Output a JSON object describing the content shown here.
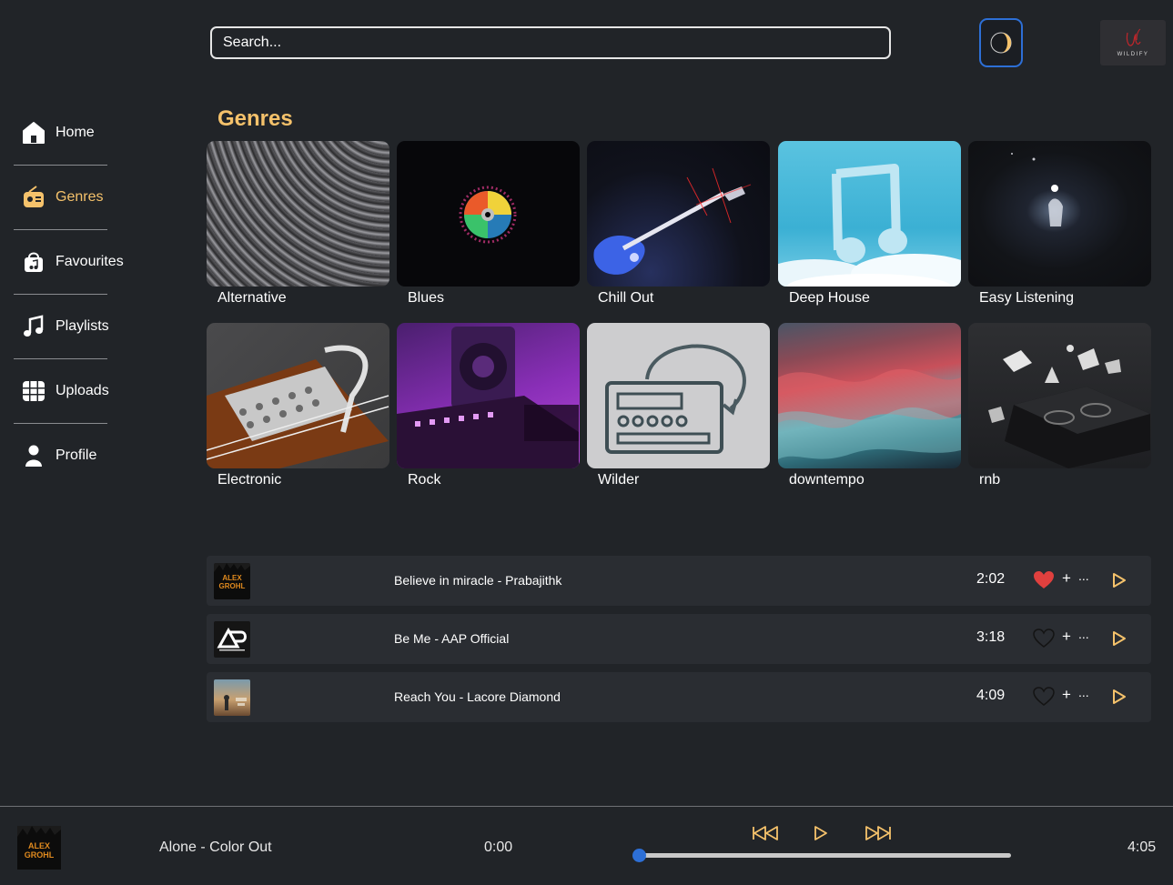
{
  "search": {
    "placeholder": "Search..."
  },
  "header": {
    "brand_text": "WILDIFY"
  },
  "sidebar": {
    "items": [
      {
        "label": "Home",
        "icon": "home-icon",
        "active": false
      },
      {
        "label": "Genres",
        "icon": "radio-icon",
        "active": true
      },
      {
        "label": "Favourites",
        "icon": "music-bag-icon",
        "active": false
      },
      {
        "label": "Playlists",
        "icon": "music-note-icon",
        "active": false
      },
      {
        "label": "Uploads",
        "icon": "grid-icon",
        "active": false
      },
      {
        "label": "Profile",
        "icon": "user-icon",
        "active": false
      }
    ]
  },
  "genres": {
    "title": "Genres",
    "items": [
      {
        "name": "Alternative",
        "image": "vinyl-record-closeup"
      },
      {
        "name": "Blues",
        "image": "rainbow-cd-on-black"
      },
      {
        "name": "Chill Out",
        "image": "blue-electric-guitar-red-light"
      },
      {
        "name": "Deep House",
        "image": "music-note-cloud-sky"
      },
      {
        "name": "Easy Listening",
        "image": "dark-stage-spotlight"
      },
      {
        "name": "Electronic",
        "image": "guitar-pickup-capo"
      },
      {
        "name": "Rock",
        "image": "purple-studio-mixer"
      },
      {
        "name": "Wilder",
        "image": "radio-drawing-on-wall"
      },
      {
        "name": "downtempo",
        "image": "red-teal-smoke"
      },
      {
        "name": "rnb",
        "image": "dj-deck-3d-shapes"
      }
    ]
  },
  "tracks": [
    {
      "title": "Believe in miracle - Prabajithk",
      "duration": "2:02",
      "liked": true,
      "thumb": "ALEX GROHL",
      "add_label": "+",
      "more_label": "..."
    },
    {
      "title": "Be Me - AAP Official",
      "duration": "3:18",
      "liked": false,
      "thumb": "AAP",
      "add_label": "+",
      "more_label": "..."
    },
    {
      "title": "Reach You - Lacore Diamond",
      "duration": "4:09",
      "liked": false,
      "thumb": "sunset-person",
      "add_label": "+",
      "more_label": "..."
    }
  ],
  "player": {
    "title": "Alone - Color Out",
    "elapsed": "0:00",
    "total": "4:05",
    "progress": 0.0,
    "thumb": "ALEX GROHL"
  },
  "colors": {
    "background": "#212428",
    "accent": "#f5c26b",
    "highlight": "#2d6fd6",
    "like": "#e0403e",
    "row": "#2a2d32"
  }
}
